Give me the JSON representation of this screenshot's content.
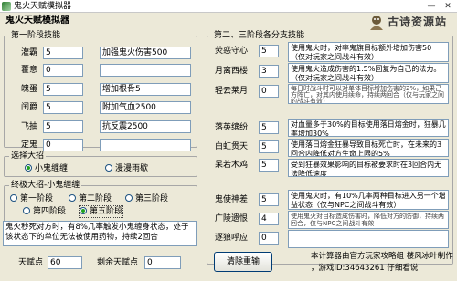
{
  "window": {
    "title": "鬼火天赋模拟器",
    "minimize": "—",
    "close": "✕"
  },
  "app_name": "鬼火天赋模拟器",
  "brand": "古诗资源站",
  "tier1": {
    "legend": "第一阶段技能",
    "rows": [
      {
        "name": "灌霸",
        "points": "5",
        "effect": "加强鬼火伤害500"
      },
      {
        "name": "藿意",
        "points": "0",
        "effect": ""
      },
      {
        "name": "魄蛋",
        "points": "5",
        "effect": "增加根骨5"
      },
      {
        "name": "闰爵",
        "points": "5",
        "effect": "附加气血2500"
      },
      {
        "name": "飞抽",
        "points": "5",
        "effect": "抗反震2500"
      },
      {
        "name": "定鬼",
        "points": "0",
        "effect": ""
      }
    ]
  },
  "choice": {
    "legend": "选择大招",
    "options": [
      "小鬼缠缠",
      "漫漫雨歇"
    ],
    "selected": 0
  },
  "final": {
    "legend": "终极大招-小鬼缠缠",
    "options": [
      "第一阶段",
      "第二阶段",
      "第三阶段",
      "第四阶段",
      "第五阶段"
    ],
    "selected": 4,
    "description": "鬼火秒死对方时，有8%几率触发小鬼缠身状态，处于该状态下的单位无法被使用药物，持续2回合"
  },
  "points": {
    "label": "天赋点",
    "value": "60",
    "remain_label": "剩余天赋点",
    "remain_value": "0"
  },
  "tier23": {
    "legend": "第二、三阶段各分支技能",
    "groups": [
      {
        "skills": [
          {
            "name": "荧惑守心",
            "points": "5"
          },
          {
            "name": "月离西楼",
            "points": "3"
          },
          {
            "name": "轻云莱月",
            "points": "0"
          }
        ],
        "desc": "使用鬼火时，对率鬼旗目标额外增加伤害50（仅对玩家之间战斗有效）",
        "desc2": "使用鬼火造成伤害的1.5%回复为自己的法力。（仅对玩家之间战斗有效）",
        "desc3": "每日时战斗时可以对单体目标增加伤害的2%，如果己方阵亡，对其内使用续命，持续两回合（仅与玩家之间的战斗有效）"
      },
      {
        "skills": [
          {
            "name": "落英缤纷",
            "points": "5"
          },
          {
            "name": "白虹贯天",
            "points": "5"
          },
          {
            "name": "呆若木鸡",
            "points": "5"
          }
        ],
        "desc": "对血量多于30%的目标使用落日熔金时，狂暴几率增加30%",
        "desc2": "使用落日熔金狂暴导致目标死亡时，在未来的3回合内降低对方生命上限的5%",
        "desc3": "受到狂暴效果影响的目标被要求时在3回合内无法降低速度"
      },
      {
        "skills": [
          {
            "name": "鬼使神差",
            "points": "5"
          },
          {
            "name": "广陵遗恨",
            "points": "4"
          },
          {
            "name": "逐狼呼应",
            "points": "0"
          }
        ],
        "desc": "使用鬼火时，有10%几率两种目标进入另一个增益状态（仅与NPC之间战斗有效）",
        "desc2": "使用鬼火对目标造成伤害时，降低对方的防御，持续两回合，仅与NPC之间战斗有效",
        "desc3": ""
      }
    ]
  },
  "reset_button": "清除重输",
  "credits": [
    "本计算器由官方玩家攻略组 楼风冰叶制作",
    "，游戏ID:34643261 仔细看说"
  ]
}
